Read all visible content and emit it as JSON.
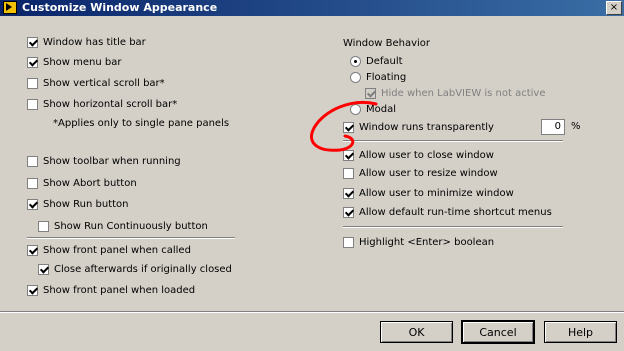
{
  "window": {
    "title": "Customize Window Appearance",
    "close_glyph": "×"
  },
  "left": {
    "window_has_title_bar": {
      "label": "Window has title bar",
      "checked": true
    },
    "show_menu_bar": {
      "label": "Show menu bar",
      "checked": true
    },
    "show_vertical_scroll_bar": {
      "label": "Show vertical scroll bar*",
      "checked": false
    },
    "show_horizontal_scroll_bar": {
      "label": "Show horizontal scroll bar*",
      "checked": false
    },
    "applies_note": "*Applies only to single pane panels",
    "show_toolbar_when_running": {
      "label": "Show toolbar when running",
      "checked": false
    },
    "show_abort_button": {
      "label": "Show Abort button",
      "checked": false
    },
    "show_run_button": {
      "label": "Show Run button",
      "checked": true
    },
    "show_run_continuously_button": {
      "label": "Show Run Continuously button",
      "checked": false
    },
    "show_front_panel_when_called": {
      "label": "Show front panel when called",
      "checked": true
    },
    "close_afterwards": {
      "label": "Close afterwards if originally closed",
      "checked": true
    },
    "show_front_panel_when_loaded": {
      "label": "Show front panel when loaded",
      "checked": true
    }
  },
  "right": {
    "window_behavior_heading": "Window Behavior",
    "default": {
      "label": "Default",
      "selected": true
    },
    "floating": {
      "label": "Floating",
      "selected": false
    },
    "hide_when_not_active": {
      "label": "Hide when LabVIEW is not active",
      "checked": true,
      "disabled": true
    },
    "modal": {
      "label": "Modal",
      "selected": false
    },
    "window_runs_transparently": {
      "label": "Window runs transparently",
      "checked": true
    },
    "transparency_value": "0",
    "transparency_unit": "%",
    "allow_close": {
      "label": "Allow user to close window",
      "checked": true
    },
    "allow_resize": {
      "label": "Allow user to resize window",
      "checked": false
    },
    "allow_minimize": {
      "label": "Allow user to minimize window",
      "checked": true
    },
    "allow_shortcut_menus": {
      "label": "Allow default run-time shortcut menus",
      "checked": true
    },
    "highlight_enter": {
      "label": "Highlight <Enter> boolean",
      "checked": false
    }
  },
  "buttons": {
    "ok": "OK",
    "cancel": "Cancel",
    "help": "Help"
  },
  "annotation": {
    "color": "#ff0000"
  }
}
